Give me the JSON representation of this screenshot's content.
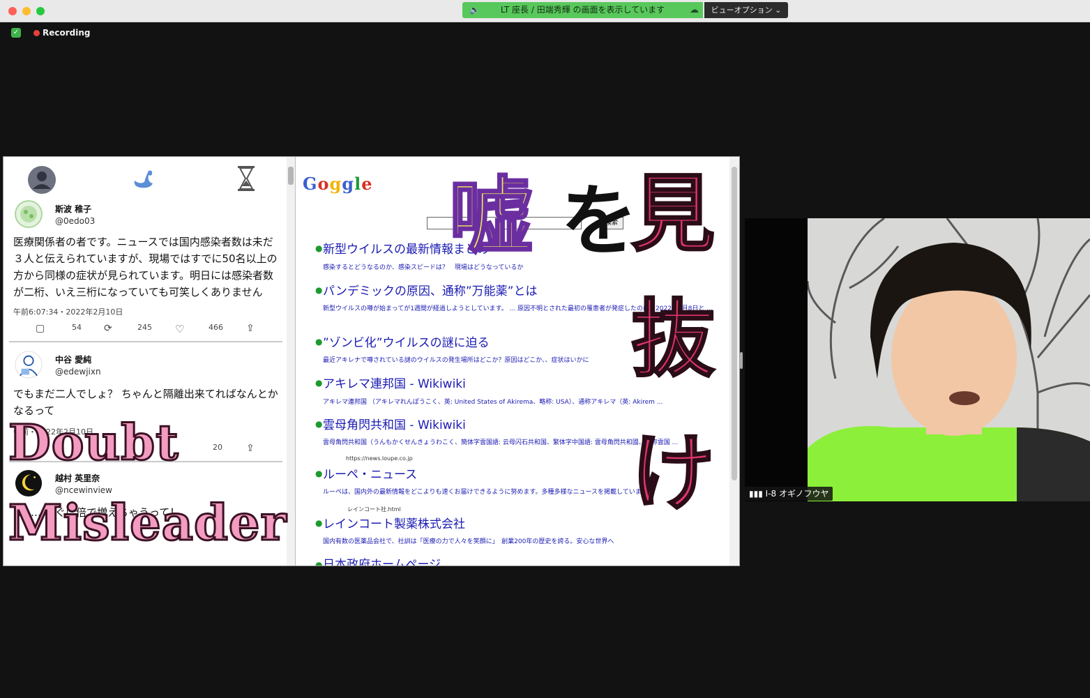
{
  "window": {
    "share_banner": "LT 座長 / 田端秀輝 の画面を表示しています",
    "view_options": "ビューオプション ⌄",
    "recording_label": "Recording"
  },
  "sns": {
    "tweets": [
      {
        "name": "斯波 稚子",
        "handle": "@0edo03",
        "body": "医療関係者の者です。ニュースでは国内感染者数は未だ３人と伝えられていますが、現場ではすでに50名以上の方から同様の症状が見られています。明日には感染者数が二桁、いえ三桁になっていても可笑しくありません",
        "date": "午前6:07:34・2022年2月10日",
        "replies": "54",
        "retweets": "245",
        "likes": "466"
      },
      {
        "name": "中谷 愛純",
        "handle": "@edewjixn",
        "body": "でもまだ二人でしょ？ ちゃんと隔離出来てればなんとかなるって",
        "date": "午前・2022年2月10日",
        "likes": "20"
      },
      {
        "name": "越村 英里奈",
        "handle": "@ncewinview",
        "body": "ヨ……すぐに倍で増えちゃうって！"
      }
    ]
  },
  "search": {
    "logo": "Goggle",
    "button": "検索",
    "results": [
      {
        "title": "新型ウイルスの最新情報まとめ",
        "snippet": "感染するとどうなるのか、感染スピードは？　現場はどうなっているか"
      },
      {
        "title": "パンデミックの原因、通称”万能薬”とは",
        "snippet": "新型ウイルスの噂が始まってが1週間が経過しようとしています。 ... 原因不明とされた最初の罹患者が発症したのは、2022年2月8日と ..."
      },
      {
        "title": "”ゾンビ化”ウイルスの謎に迫る",
        "snippet": "最近アキレナで噂されている謎のウイルスの発生場所はどこか？原因はどこか、、症状はいかに"
      },
      {
        "title": "アキレマ連邦国 - Wikiwiki",
        "snippet": "アキレマ連邦国 （アキレマれんぽうこく、英: United States of Akirema、略称: USA）、通称アキレマ（英: Akirem ..."
      },
      {
        "title": "雲母角閃共和国 - Wikiwiki",
        "snippet": "雲母角閃共和国（うんもかくせんきょうわこく、簡体字雲国語: 云母闪石共和国、繁体字中国語: 雲母角閃共和國、通称雲国 ..."
      },
      {
        "url": "https://news.loupe.co.jp",
        "title": "ルーペ・ニュース",
        "snippet": "ルーペは、国内外の最新情報をどこよりも速くお届けできるように努めます。多種多様なニュースを掲載しています。"
      },
      {
        "url": "レインコート社.html",
        "title": "レインコート製薬株式会社",
        "snippet": "国内有数の医薬品会社で、社訓は「医療の力で人々を笑顔に」　創業200年の歴史を誇る。安心な世界へ"
      },
      {
        "title": "日本政府ホームページ"
      }
    ]
  },
  "overlay": {
    "uso": "嘘",
    "wo": "を",
    "mi": "見",
    "nu": "抜",
    "ke": "け",
    "title_line1": "Doubt",
    "title_line2": "Misleader"
  },
  "participant": {
    "name": "I-8 オギノフウヤ"
  }
}
